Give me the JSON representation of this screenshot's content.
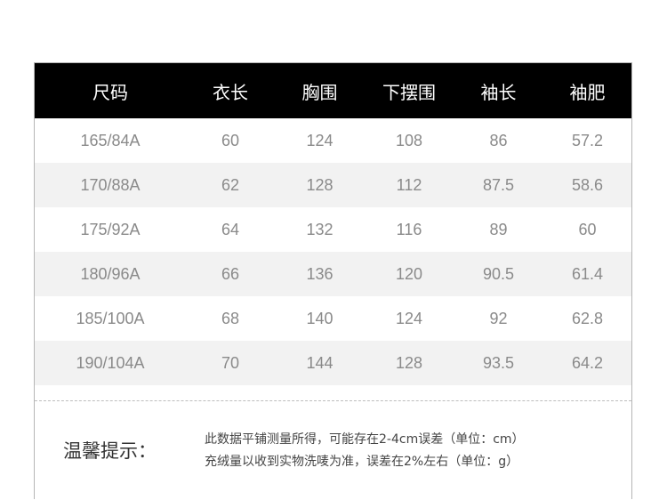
{
  "table": {
    "headers": [
      "尺码",
      "衣长",
      "胸围",
      "下摆围",
      "袖长",
      "袖肥"
    ],
    "rows": [
      [
        "165/84A",
        "60",
        "124",
        "108",
        "86",
        "57.2"
      ],
      [
        "170/88A",
        "62",
        "128",
        "112",
        "87.5",
        "58.6"
      ],
      [
        "175/92A",
        "64",
        "132",
        "116",
        "89",
        "60"
      ],
      [
        "180/96A",
        "66",
        "136",
        "120",
        "90.5",
        "61.4"
      ],
      [
        "185/100A",
        "68",
        "140",
        "124",
        "92",
        "62.8"
      ],
      [
        "190/104A",
        "70",
        "144",
        "128",
        "93.5",
        "64.2"
      ]
    ],
    "header_bg": "#000000",
    "stripe_bg": "#f2f2f2"
  },
  "tips": {
    "label": "温馨提示：",
    "notes": [
      "此数据平铺测量所得，可能存在2-4cm误差（单位：cm）",
      "充绒量以收到实物洗唛为准，误差在2%左右（单位：g）"
    ]
  }
}
